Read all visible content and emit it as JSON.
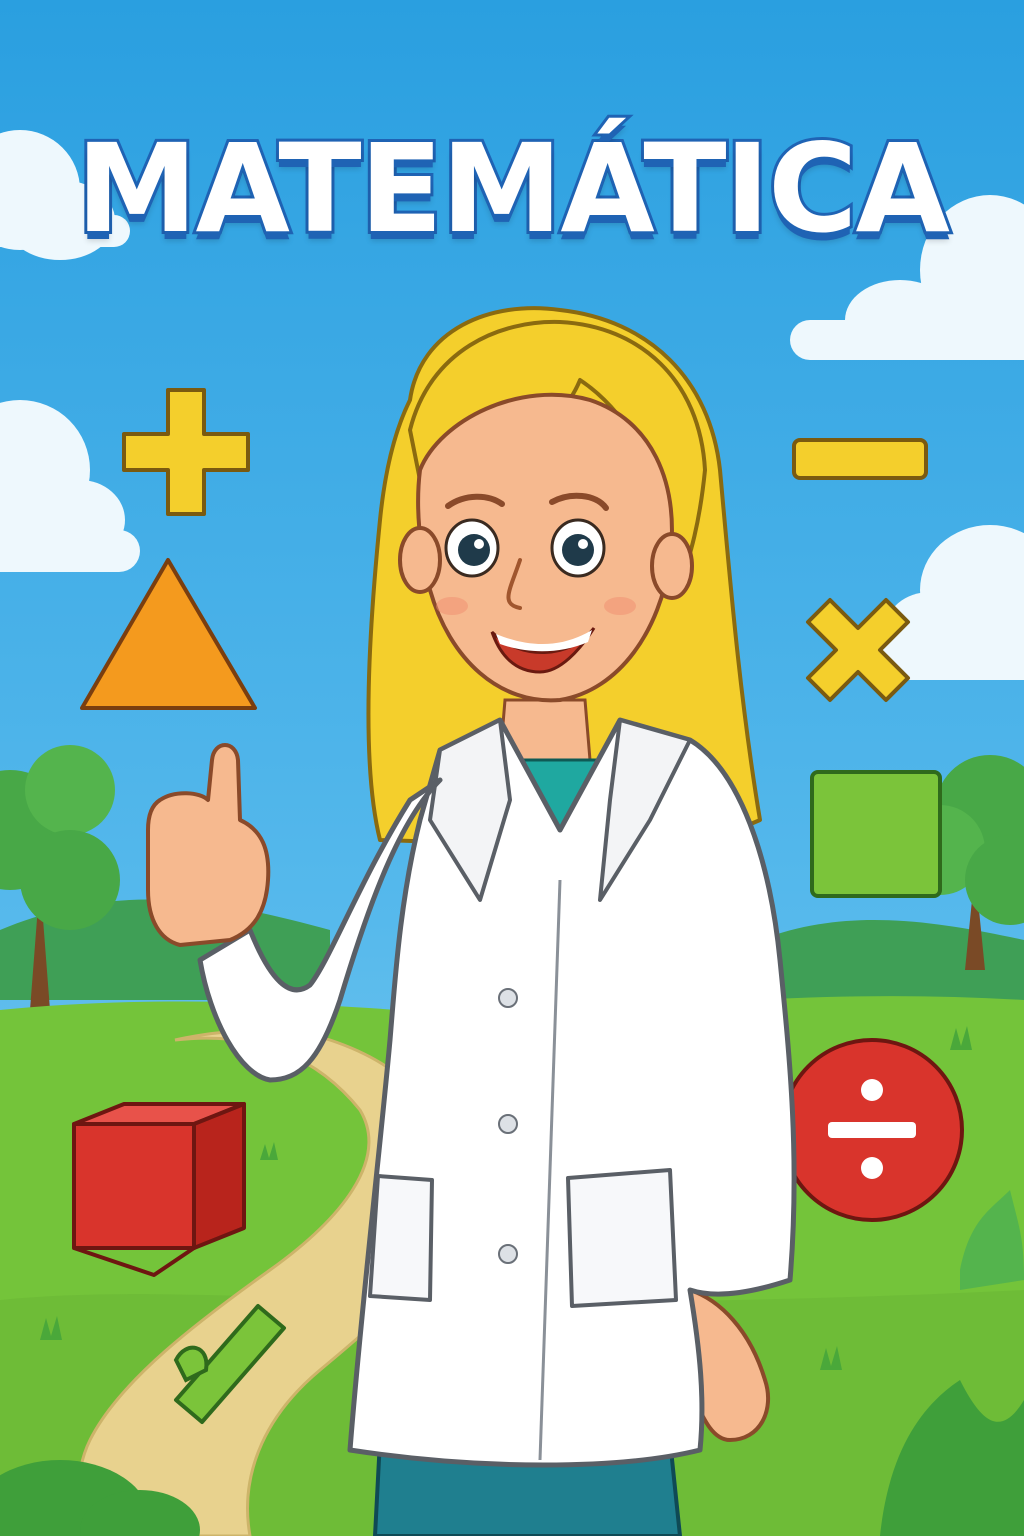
{
  "poster": {
    "title": "MATEMÁTICA",
    "colors": {
      "sky": "#38ace6",
      "grass": "#74c43a",
      "path": "#e8d28e",
      "title_outline": "#1f63b4",
      "hair": "#f4cf2c",
      "coat": "#ffffff",
      "shirt": "#1fa8a0",
      "pants": "#1f7f8f"
    },
    "symbols": [
      {
        "name": "plus-icon",
        "color": "#f4cf2c"
      },
      {
        "name": "minus-icon",
        "color": "#f4cf2c"
      },
      {
        "name": "triangle-icon",
        "color": "#f49a1e"
      },
      {
        "name": "multiply-icon",
        "color": "#f4cf2c"
      },
      {
        "name": "square-icon",
        "color": "#7bc43a"
      },
      {
        "name": "cube-icon",
        "color": "#d9342c"
      },
      {
        "name": "divide-icon",
        "color": "#d9342c"
      },
      {
        "name": "ruler-icon",
        "color": "#7bc43a"
      }
    ]
  }
}
